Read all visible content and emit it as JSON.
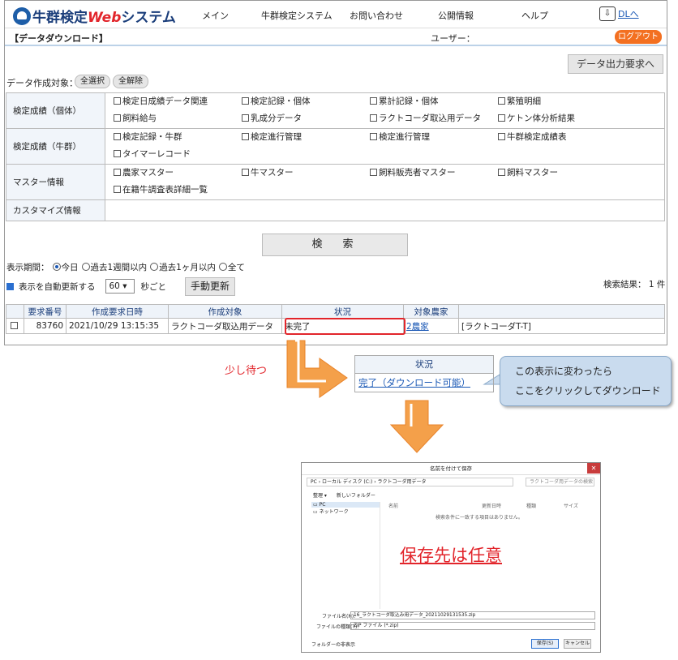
{
  "nav": {
    "logo_prefix": "牛群検定",
    "logo_web": "Web",
    "logo_suffix": "システム",
    "items": [
      "メイン",
      "牛群検定システム",
      "お問い合わせ",
      "公開情報",
      "ヘルプ"
    ],
    "dl_label": "DLへ"
  },
  "header": {
    "page_title": "【データダウンロード】",
    "user_label": "ユーザー：",
    "logout": "ログアウト"
  },
  "toolbar": {
    "request_button": "データ出力要求へ",
    "target_label": "データ作成対象：",
    "select_all": "全選択",
    "clear_all": "全解除"
  },
  "categories": [
    {
      "name": "検定成績（個体）",
      "options": [
        "検定日成績データ関連",
        "検定記録・個体",
        "累計記録・個体",
        "繁殖明細",
        "飼料給与",
        "乳成分データ",
        "ラクトコーダ取込用データ",
        "ケトン体分析結果"
      ]
    },
    {
      "name": "検定成績（牛群）",
      "options": [
        "検定記録・牛群",
        "検定進行管理",
        "検定進行管理",
        "牛群検定成績表",
        "タイマーレコード"
      ]
    },
    {
      "name": "マスター情報",
      "options": [
        "農家マスター",
        "牛マスター",
        "飼料販売者マスター",
        "飼料マスター",
        "在籍牛調査表詳細一覧"
      ]
    },
    {
      "name": "カスタマイズ情報",
      "options": []
    }
  ],
  "search": {
    "button": "検　索",
    "period_label": "表示期間：",
    "periods": [
      "今日",
      "過去1週間以内",
      "過去1ヶ月以内",
      "全て"
    ],
    "auto_refresh": "表示を自動更新する",
    "seconds": "60",
    "seconds_suffix": "秒ごと",
    "manual_refresh": "手動更新",
    "result_count": "検索結果： 1 件"
  },
  "results": {
    "headers": [
      "要求番号",
      "作成要求日時",
      "作成対象",
      "状況",
      "対象農家",
      ""
    ],
    "rows": [
      {
        "id": "83760",
        "datetime": "2021/10/29 13:15:35",
        "target": "ラクトコーダ取込用データ",
        "status": "未完了",
        "farm": "2農家",
        "note": "[ラクトコーダT-T]"
      }
    ]
  },
  "annotation": {
    "wait": "少し待つ",
    "status_header": "状況",
    "status_done": "完了（ダウンロード可能）",
    "callout_line1": "この表示に変わったら",
    "callout_line2": "ここをクリックしてダウンロード",
    "save_to": "保存先は任意"
  },
  "dialog": {
    "title": "名前を付けて保存",
    "address": "PC › ローカル ディスク (C:) › ラクトコーダ用データ",
    "search_placeholder": "ラクトコーダ用データの検索",
    "organize": "整理 ▾",
    "new_folder": "新しいフォルダー",
    "tree": [
      "PC",
      "ネットワーク"
    ],
    "columns": [
      "名前",
      "更新日時",
      "種類",
      "サイズ"
    ],
    "empty": "検索条件に一致する項目はありません。",
    "filename_label": "ファイル名(N):",
    "filename": "16_ラクトコーダ取込み用データ_20211029131535.zip",
    "filetype_label": "ファイルの種類(T):",
    "filetype": "ZIP ファイル (*.zip)",
    "hide_folders": "フォルダーの非表示",
    "save": "保存(S)",
    "cancel": "キャンセル"
  },
  "colors": {
    "accent_red": "#e2252b",
    "orange": "#f37021",
    "link": "#1a58b5",
    "arrow": "#f4a04a"
  }
}
